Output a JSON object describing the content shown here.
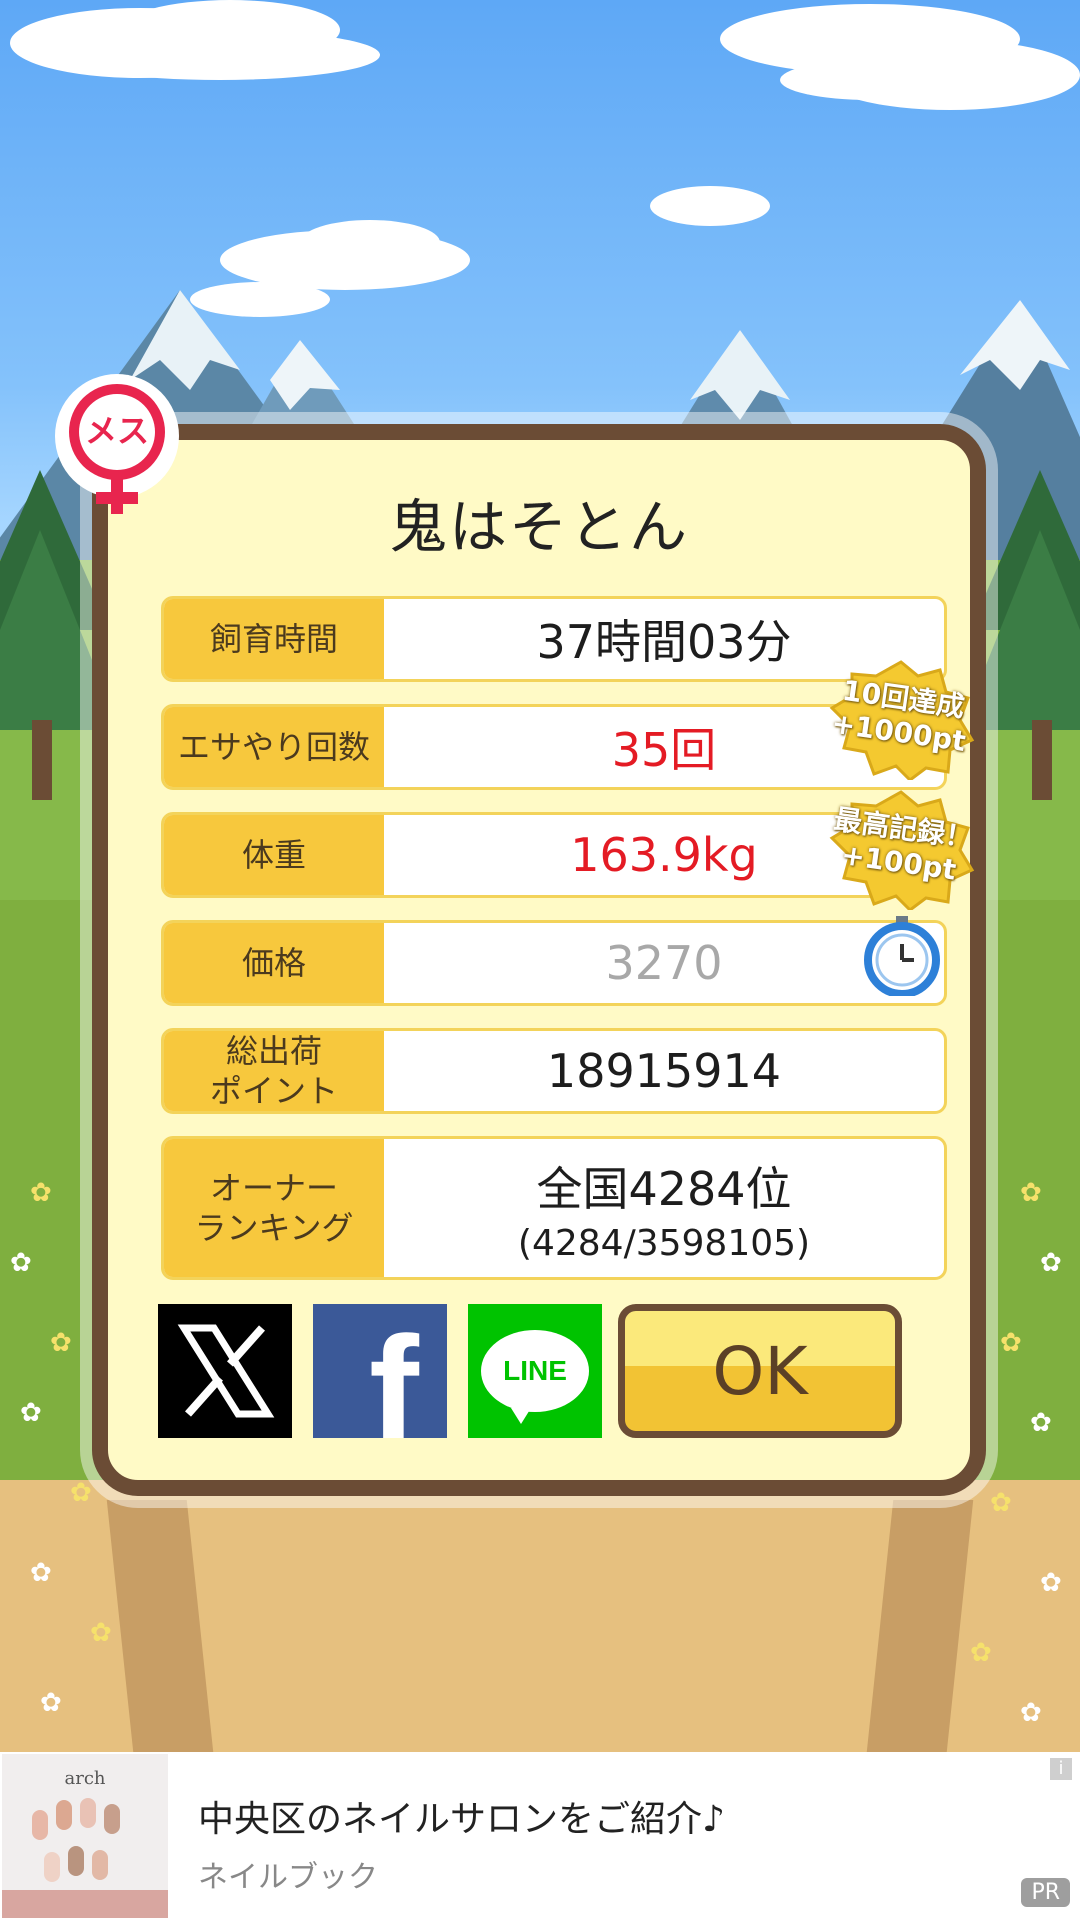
{
  "pet": {
    "gender_label": "メス",
    "name": "鬼はそとん"
  },
  "stats": [
    {
      "label": "飼育時間",
      "value": "37時間03分"
    },
    {
      "label": "エサやり回数",
      "value": "35回"
    },
    {
      "label": "体重",
      "value": "163.9kg"
    },
    {
      "label": "価格",
      "value": "3270"
    },
    {
      "label": "総出荷\nポイント",
      "value": "18915914"
    },
    {
      "label": "オーナー\nランキング",
      "value": "全国4284位",
      "sub": "(4284/3598105)"
    }
  ],
  "badges": [
    {
      "line1": "10回達成",
      "line2": "+1000pt"
    },
    {
      "line1": "最高記録！",
      "line2": "+100pt"
    }
  ],
  "share": {
    "x_label": "X",
    "facebook_label": "f",
    "line_label": "LINE"
  },
  "ok_label": "OK",
  "ad": {
    "title": "中央区のネイルサロンをご紹介♪",
    "source": "ネイルブック",
    "brand": "arch",
    "info": "i",
    "pr": "PR"
  },
  "colors": {
    "panel_bg": "#fffac6",
    "panel_border": "#6b4c35",
    "label_bg": "#f7c83d",
    "highlight_red": "#e41b24",
    "x_bg": "#000000",
    "facebook_bg": "#3b5998",
    "line_bg": "#00c300"
  }
}
